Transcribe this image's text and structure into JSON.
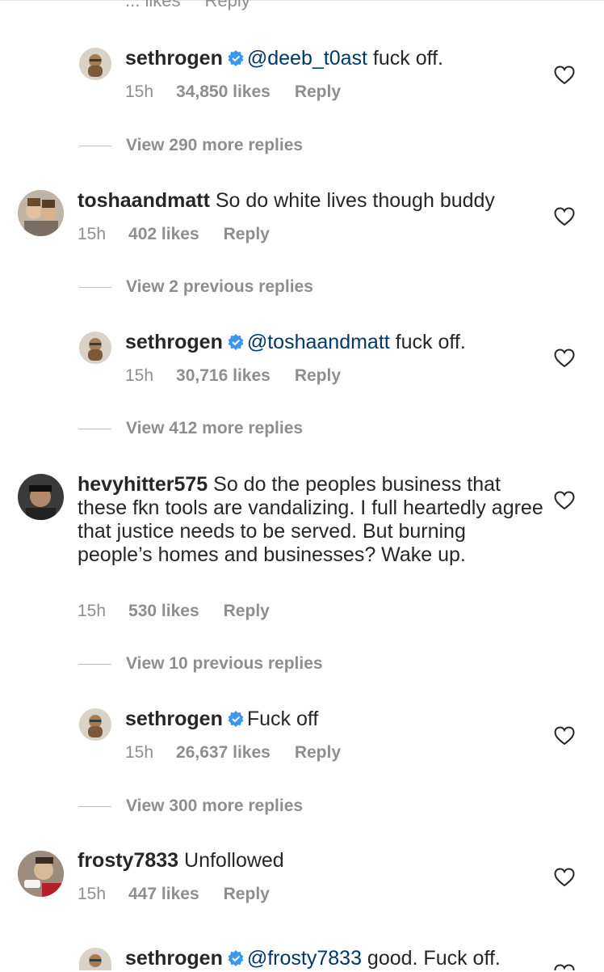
{
  "top_partial": {
    "likes": "... likes",
    "reply": "Reply"
  },
  "icons": {
    "verified": "verified-badge-icon",
    "like": "heart-outline-icon"
  },
  "colors": {
    "verified": "#3897f0",
    "mention": "#00376b",
    "meta": "#8e8e8e",
    "text": "#262626"
  },
  "threads": [
    {
      "type": "reply",
      "username": "sethrogen",
      "verified": true,
      "mention": "@deeb_t0ast",
      "text": " fuck off.",
      "time": "15h",
      "likes": "34,850 likes",
      "reply": "Reply"
    },
    {
      "type": "view",
      "label": "View 290 more replies"
    },
    {
      "type": "comment",
      "username": "toshaandmatt",
      "text": "So do white lives though buddy",
      "time": "15h",
      "likes": "402 likes",
      "reply": "Reply"
    },
    {
      "type": "view",
      "label": "View 2 previous replies"
    },
    {
      "type": "reply",
      "username": "sethrogen",
      "verified": true,
      "mention": "@toshaandmatt",
      "text": " fuck off.",
      "time": "15h",
      "likes": "30,716 likes",
      "reply": "Reply"
    },
    {
      "type": "view",
      "label": "View 412 more replies"
    },
    {
      "type": "comment",
      "username": "hevyhitter575",
      "text": "So do the peoples business that these fkn tools are vandalizing.  I full heartedly agree that justice needs to be served.  But burning people’s homes and businesses? Wake up.",
      "time": "15h",
      "likes": "530 likes",
      "reply": "Reply"
    },
    {
      "type": "view",
      "label": "View 10 previous replies"
    },
    {
      "type": "reply",
      "username": "sethrogen",
      "verified": true,
      "mention": "",
      "text": "Fuck off",
      "time": "15h",
      "likes": "26,637 likes",
      "reply": "Reply"
    },
    {
      "type": "view",
      "label": "View 300 more replies"
    },
    {
      "type": "comment",
      "username": "frosty7833",
      "text": "Unfollowed",
      "time": "15h",
      "likes": "447 likes",
      "reply": "Reply"
    },
    {
      "type": "reply",
      "username": "sethrogen",
      "verified": true,
      "mention": "@frosty7833",
      "text": " good. Fuck off.",
      "time": "",
      "likes": "",
      "reply": ""
    }
  ]
}
